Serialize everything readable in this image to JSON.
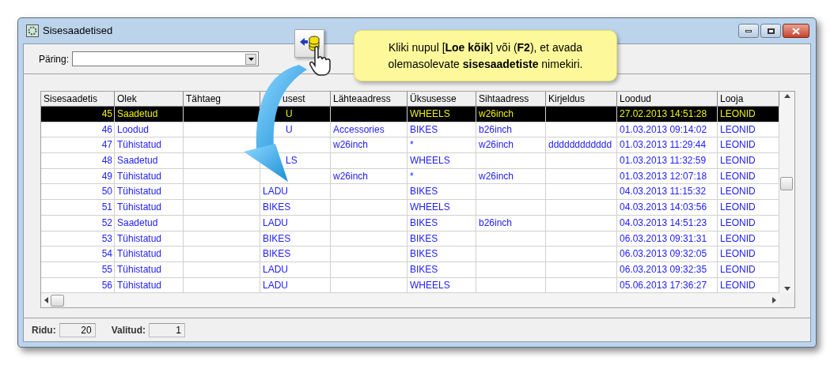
{
  "window": {
    "title": "Sisesaadetised"
  },
  "query": {
    "label": "Päring:"
  },
  "callout": {
    "text": "Kliki nupul [**Loe kõik**] või (**F2**), et avada\nolemasolevate **sisesaadetiste** nimekiri."
  },
  "table": {
    "columns": [
      {
        "label": "Sisesaadetis",
        "partly_hidden": false
      },
      {
        "label": "Olek",
        "partly_hidden": false
      },
      {
        "label": "Tähtaeg",
        "partly_hidden": false
      },
      {
        "label": "usest",
        "partly_hidden": true
      },
      {
        "label": "Lähteaadress",
        "partly_hidden": false
      },
      {
        "label": "Üksusesse",
        "partly_hidden": false
      },
      {
        "label": "Sihtaadress",
        "partly_hidden": false
      },
      {
        "label": "Kirjeldus",
        "partly_hidden": false
      },
      {
        "label": "Loodud",
        "partly_hidden": false
      },
      {
        "label": "Looja",
        "partly_hidden": false
      }
    ],
    "rows": [
      {
        "selected": true,
        "partly_hidden": true,
        "cells": [
          "45",
          "Saadetud",
          null,
          "U",
          null,
          "WHEELS",
          "w26inch",
          null,
          "27.02.2013 14:51:28",
          "LEONID"
        ]
      },
      {
        "selected": false,
        "partly_hidden": true,
        "cells": [
          "46",
          "Loodud",
          null,
          "U",
          "Accessories",
          "BIKES",
          "b26inch",
          null,
          "01.03.2013 09:14:02",
          "LEONID"
        ]
      },
      {
        "selected": false,
        "cells": [
          "47",
          "Tühistatud",
          null,
          null,
          "w26inch",
          "*",
          "w26inch",
          "dddddddddddd",
          "01.03.2013 11:29:44",
          "LEONID"
        ]
      },
      {
        "selected": false,
        "partly_hidden": true,
        "cells": [
          "48",
          "Saadetud",
          null,
          "LS",
          null,
          "WHEELS",
          null,
          null,
          "01.03.2013 11:32:59",
          "LEONID"
        ]
      },
      {
        "selected": false,
        "cells": [
          "49",
          "Tühistatud",
          null,
          null,
          "w26inch",
          "*",
          "w26inch",
          null,
          "01.03.2013 12:07:18",
          "LEONID"
        ]
      },
      {
        "selected": false,
        "partly_hidden": false,
        "cells": [
          "50",
          "Tühistatud",
          null,
          "LADU",
          null,
          "BIKES",
          null,
          null,
          "04.03.2013 11:15:32",
          "LEONID"
        ]
      },
      {
        "selected": false,
        "partly_hidden": false,
        "cells": [
          "51",
          "Tühistatud",
          null,
          "BIKES",
          null,
          "WHEELS",
          null,
          null,
          "04.03.2013 14:03:56",
          "LEONID"
        ]
      },
      {
        "selected": false,
        "partly_hidden": false,
        "cells": [
          "52",
          "Saadetud",
          null,
          "LADU",
          null,
          "BIKES",
          "b26inch",
          null,
          "04.03.2013 14:51:23",
          "LEONID"
        ]
      },
      {
        "selected": false,
        "partly_hidden": false,
        "cells": [
          "53",
          "Tühistatud",
          null,
          "BIKES",
          null,
          "BIKES",
          null,
          null,
          "06.03.2013 09:31:31",
          "LEONID"
        ]
      },
      {
        "selected": false,
        "partly_hidden": false,
        "cells": [
          "54",
          "Tühistatud",
          null,
          "BIKES",
          null,
          "BIKES",
          null,
          null,
          "06.03.2013 09:32:05",
          "LEONID"
        ]
      },
      {
        "selected": false,
        "partly_hidden": false,
        "cells": [
          "55",
          "Tühistatud",
          null,
          "LADU",
          null,
          "BIKES",
          null,
          null,
          "06.03.2013 09:32:35",
          "LEONID"
        ]
      },
      {
        "selected": false,
        "partly_hidden": false,
        "cells": [
          "56",
          "Tühistatud",
          null,
          "LADU",
          null,
          "WHEELS",
          null,
          null,
          "05.06.2013 17:36:27",
          "LEONID"
        ]
      }
    ]
  },
  "status_bar": {
    "rows_label": "Ridu:",
    "rows_value": "20",
    "selected_label": "Valitud:",
    "selected_value": "1"
  }
}
